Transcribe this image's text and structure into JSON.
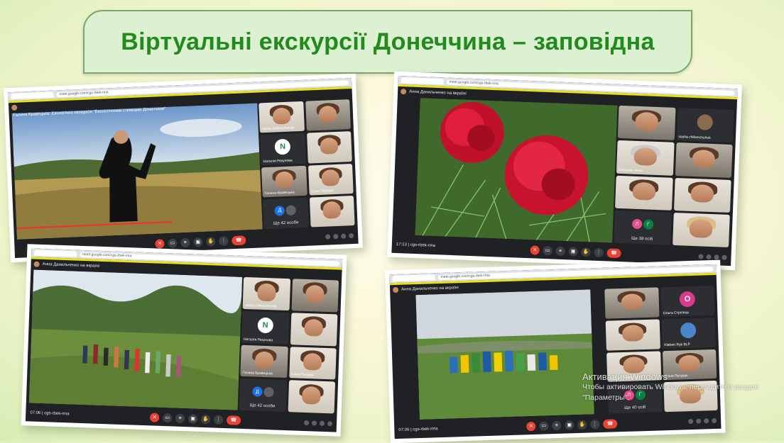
{
  "slide_title": "Віртуальні екскурсії Донеччина – заповідна",
  "shots": [
    {
      "address": "meet.google.com/cgs-rbek-rma",
      "meeting_label": "",
      "video_caption": "Галина Кравецька. Екологічна екскурсія \"Екологічними стежками Донеччини\"",
      "bottom_left": "",
      "tiles": [
        {
          "name": "sasha chikanchuhuk"
        },
        {
          "name": ""
        },
        {
          "name": "Наталія Рекунова",
          "initial": "N"
        },
        {
          "name": ""
        },
        {
          "name": "Галина Кравецька"
        },
        {
          "name": "Соня Погурак"
        },
        {
          "name": "Ще 42 особи",
          "initials": [
            "Д",
            ""
          ]
        },
        {
          "name": ""
        }
      ]
    },
    {
      "address": "meet.google.com/cgs-rbek-rma",
      "meeting_label": "Анна Данильченко на вкраїні",
      "bottom_left": "17:13 | cgs-rbek-rma",
      "tiles": [
        {
          "name": ""
        },
        {
          "name": "sasha chikanchuhuk"
        },
        {
          "name": "Коніцева Анна"
        },
        {
          "name": ""
        },
        {
          "name": ""
        },
        {
          "name": ""
        },
        {
          "name": "Ще 38 осіб",
          "initials": [
            "Л",
            "Г"
          ]
        },
        {
          "name": ""
        }
      ]
    },
    {
      "address": "meet.google.com/cgs-rbek-rma",
      "meeting_label": "Анна Данильченко на вкраїні",
      "bottom_left": "07:06 | cgs-rbek-rma",
      "tiles": [
        {
          "name": "sasha chikanchuhuk"
        },
        {
          "name": ""
        },
        {
          "name": "Наталія Рекунова",
          "initial": "N"
        },
        {
          "name": ""
        },
        {
          "name": "Галина Кравецька"
        },
        {
          "name": "Соня Погурак"
        },
        {
          "name": "Ще 42 особи"
        },
        {
          "name": ""
        }
      ]
    },
    {
      "address": "meet.google.com/cgs-rbek-rma",
      "meeting_label": "Анна Данильченко на вкраїні",
      "bottom_left": "07:06 | cgs-rbek-rma",
      "tiles": [
        {
          "name": ""
        },
        {
          "name": "Ольга Стрілець",
          "initial": "О"
        },
        {
          "name": ""
        },
        {
          "name": "Klebert Ryk BLP"
        },
        {
          "name": "sasha chikanchuhuk"
        },
        {
          "name": "Соня Погурак"
        },
        {
          "name": "Ще 40 осіб",
          "initials": [
            "Л",
            "Г"
          ]
        },
        {
          "name": ""
        }
      ]
    }
  ],
  "watermark": {
    "line1": "Активация Windows",
    "line2": "Чтобы активировать Windows, перейдите в раздел",
    "line3": "\"Параметры\"."
  },
  "colors": {
    "title_green": "#238a1d",
    "title_bg": "#dcf1d2",
    "meet_dark": "#202124",
    "end_call_red": "#ea4335"
  }
}
